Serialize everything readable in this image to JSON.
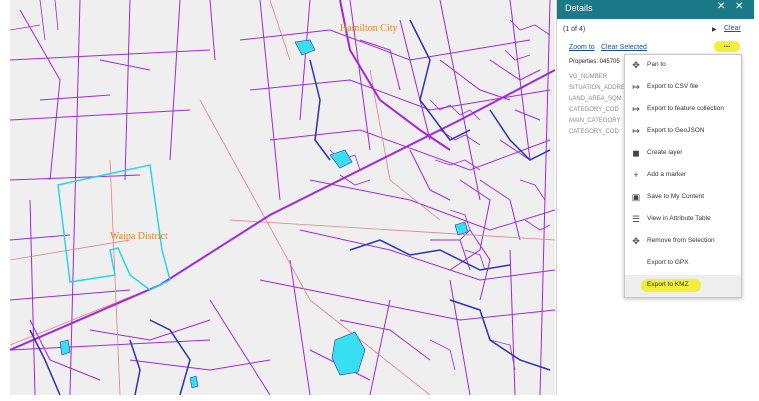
{
  "map": {
    "labels": {
      "city": "Hamilton City",
      "district": "Waipa District"
    },
    "colors": {
      "parcel": "#a427d9",
      "road": "#e57f8b",
      "river": "#2933b3",
      "water": "#37dff0",
      "selection": "#27d6e6"
    }
  },
  "panel": {
    "title": "Details",
    "count": "(1 of 4)",
    "clear": "Clear",
    "zoom_to": "Zoom to",
    "clear_selected": "Clear Selected",
    "more": "...",
    "properties": "Properties: 045705",
    "fields": [
      "VG_NUMBER",
      "SITUATION_ADDRE",
      "LAND_AREA_SQM",
      "CATEGORY_COD",
      "MAIN_CATEGORY",
      "CATEGORY_COD"
    ],
    "header_icons": [
      "collapse-icon",
      "close-icon"
    ]
  },
  "menu": {
    "items": [
      {
        "label": "Pan to",
        "icon": "pan-icon"
      },
      {
        "label": "Export to CSV file",
        "icon": "export-icon"
      },
      {
        "label": "Export to feature collection",
        "icon": "export-icon"
      },
      {
        "label": "Export to GeoJSON",
        "icon": "export-icon"
      },
      {
        "label": "Create layer",
        "icon": "layer-icon"
      },
      {
        "label": "Add a marker",
        "icon": "plus-icon"
      },
      {
        "label": "Save to My Content",
        "icon": "save-icon"
      },
      {
        "label": "View in Attribute Table",
        "icon": "table-icon"
      },
      {
        "label": "Remove from Selection",
        "icon": "remove-icon"
      },
      {
        "label": "Export to GPX",
        "icon": ""
      },
      {
        "label": "Export to KMZ",
        "icon": "",
        "highlighted": true
      }
    ]
  }
}
